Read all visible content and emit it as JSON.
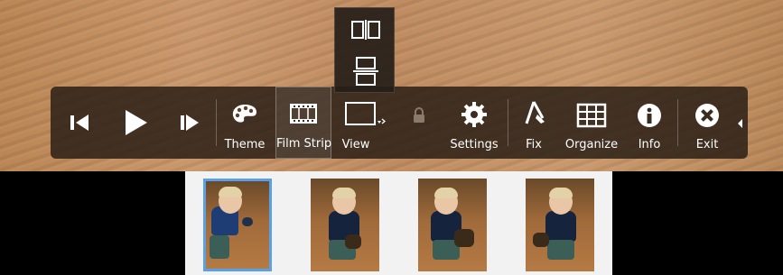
{
  "toolbar": {
    "buttons": {
      "previous": {
        "icon": "previous-icon"
      },
      "play": {
        "icon": "play-icon"
      },
      "next": {
        "icon": "next-icon"
      },
      "theme": {
        "label": "Theme",
        "icon": "palette-icon"
      },
      "film_strip": {
        "label": "Film Strip",
        "icon": "film-strip-icon"
      },
      "view": {
        "label": "View",
        "icon": "view-icon"
      },
      "lock": {
        "icon": "lock-icon"
      },
      "settings": {
        "label": "Settings",
        "icon": "gear-icon"
      },
      "fix": {
        "label": "Fix",
        "icon": "fix-icon"
      },
      "organize": {
        "label": "Organize",
        "icon": "grid-icon"
      },
      "info": {
        "label": "Info",
        "icon": "info-icon"
      },
      "exit": {
        "label": "Exit",
        "icon": "close-icon"
      }
    },
    "colors": {
      "toolbar_bg": "#281e16",
      "text": "#ffffff",
      "selection": "#5aa0e6"
    }
  },
  "view_popup": {
    "options": [
      {
        "icon": "side-by-side-icon"
      },
      {
        "icon": "stacked-icon"
      }
    ]
  },
  "filmstrip": {
    "thumbnails": [
      {
        "selected": true
      },
      {
        "selected": false
      },
      {
        "selected": false
      },
      {
        "selected": false
      }
    ]
  }
}
